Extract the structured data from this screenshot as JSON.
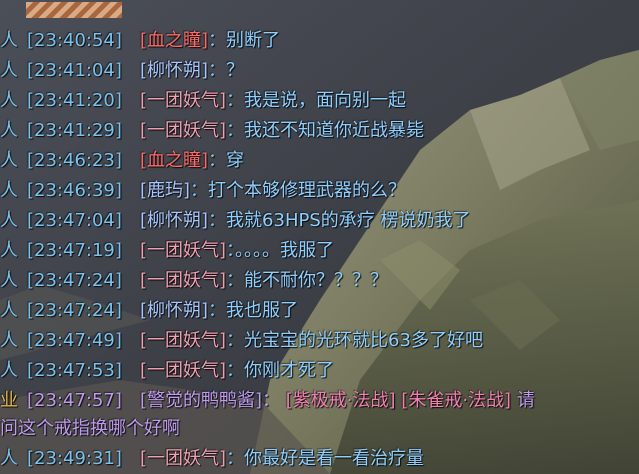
{
  "colors": {
    "time": "#7bc3ef",
    "message": "#8fd0ff",
    "sender_red": "#ff6a6a",
    "sender_pink": "#f1a0b2",
    "sender_blue": "#a8c6ff",
    "guild": "#c09cf0",
    "item_link": "#f27eb2"
  },
  "chat": {
    "lines": [
      {
        "channel": "人",
        "time": "[23:40:54]",
        "sender": "[血之瞳]",
        "sep": "：",
        "msg": "别断了"
      },
      {
        "channel": "人",
        "time": "[23:41:04]",
        "sender": "[柳怀朔]",
        "sep": "：",
        "msg": "？"
      },
      {
        "channel": "人",
        "time": "[23:41:20]",
        "sender": "[一团妖气]",
        "sep": "：",
        "msg": "我是说，面向别一起"
      },
      {
        "channel": "人",
        "time": "[23:41:29]",
        "sender": "[一团妖气]",
        "sep": "：",
        "msg": "我还不知道你近战暴毙"
      },
      {
        "channel": "人",
        "time": "[23:46:23]",
        "sender": "[血之瞳]",
        "sep": "：",
        "msg": "穿"
      },
      {
        "channel": "人",
        "time": "[23:46:39]",
        "sender": "[鹿玙]",
        "sep": "：",
        "msg": "打个本够修理武器的么？"
      },
      {
        "channel": "人",
        "time": "[23:47:04]",
        "sender": "[柳怀朔]",
        "sep": "：",
        "msg": "我就63HPS的承疗 楞说奶我了"
      },
      {
        "channel": "人",
        "time": "[23:47:19]",
        "sender": "[一团妖气]",
        "sep": "：",
        "msg": "。。。。我服了"
      },
      {
        "channel": "人",
        "time": "[23:47:24]",
        "sender": "[一团妖气]",
        "sep": "：",
        "msg": "能不耐你？？？？"
      },
      {
        "channel": "人",
        "time": "[23:47:24]",
        "sender": "[柳怀朔]",
        "sep": "：",
        "msg": "我也服了"
      },
      {
        "channel": "人",
        "time": "[23:47:49]",
        "sender": "[一团妖气]",
        "sep": "：",
        "msg": "光宝宝的光环就比63多了好吧"
      },
      {
        "channel": "人",
        "time": "[23:47:53]",
        "sender": "[一团妖气]",
        "sep": "：",
        "msg": "你刚才死了"
      },
      {
        "channel": "业",
        "time": "[23:47:57]",
        "sender": "[警觉的鸭鸭酱]",
        "sep": "：",
        "item1": "[紫极戒·法战]",
        "item2": "[朱雀戒·法战]",
        "msg": "请",
        "msg2": "问这个戒指换哪个好啊"
      },
      {
        "channel": "人",
        "time": "[23:49:31]",
        "sender": "[一团妖气]",
        "sep": "：",
        "msg": "你最好是看一看治疗量"
      }
    ]
  }
}
